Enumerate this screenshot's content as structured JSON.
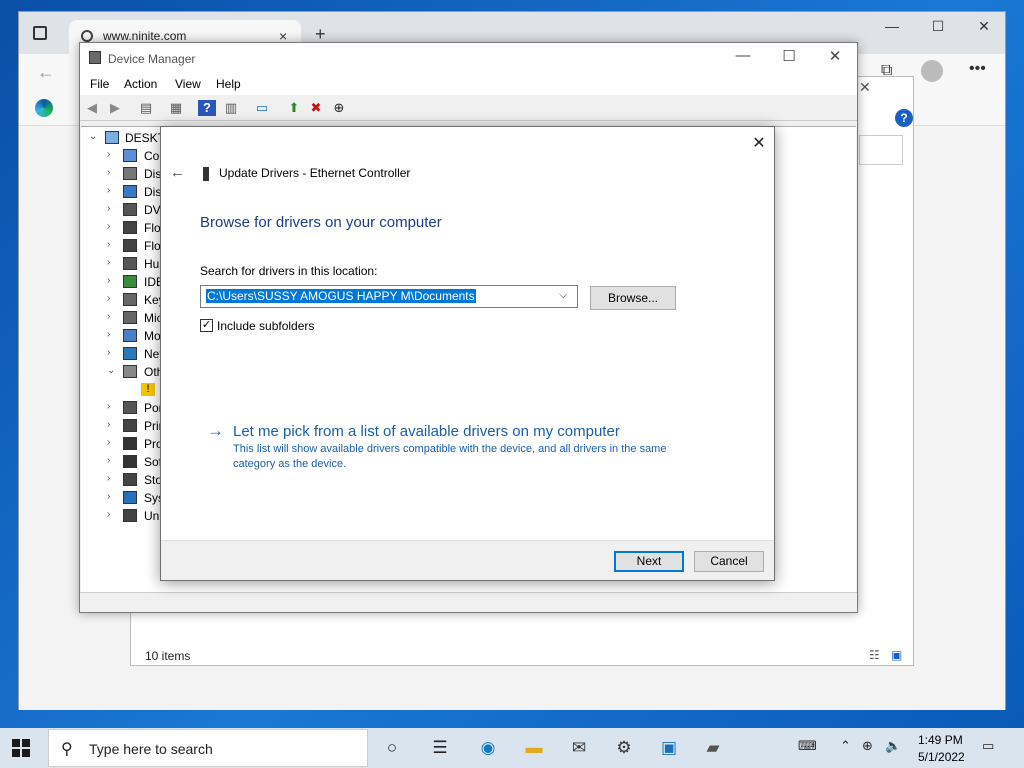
{
  "browser": {
    "tab_title": "www.ninite.com",
    "tab_close": "×",
    "new_tab": "+",
    "minimize": "—",
    "maximize": "☐",
    "close": "✕"
  },
  "explorer": {
    "status_items": "10 items"
  },
  "device_manager": {
    "title": "Device Manager",
    "minimize": "—",
    "maximize": "☐",
    "close": "✕",
    "menu": [
      "File",
      "Action",
      "View",
      "Help"
    ],
    "tree_root": "DESKTO",
    "tree_items": [
      {
        "label": "Cor",
        "expand": "›"
      },
      {
        "label": "Disk",
        "expand": "›"
      },
      {
        "label": "Disp",
        "expand": "›"
      },
      {
        "label": "DVD",
        "expand": "›"
      },
      {
        "label": "Flop",
        "expand": "›"
      },
      {
        "label": "Flop",
        "expand": "›"
      },
      {
        "label": "Hun",
        "expand": "›"
      },
      {
        "label": "IDE",
        "expand": "›"
      },
      {
        "label": "Key",
        "expand": "›"
      },
      {
        "label": "Mic",
        "expand": "›"
      },
      {
        "label": "Mo",
        "expand": "›"
      },
      {
        "label": "Net",
        "expand": "›"
      },
      {
        "label": "Oth",
        "expand": "⌄"
      },
      {
        "label": "",
        "expand": ""
      },
      {
        "label": "Por",
        "expand": "›"
      },
      {
        "label": "Prin",
        "expand": "›"
      },
      {
        "label": "Pro",
        "expand": "›"
      },
      {
        "label": "Sof",
        "expand": "›"
      },
      {
        "label": "Sto",
        "expand": "›"
      },
      {
        "label": "Syst",
        "expand": "›"
      },
      {
        "label": "Uni",
        "expand": "›"
      }
    ]
  },
  "dialog": {
    "title": "Update Drivers - Ethernet Controller",
    "close": "✕",
    "back": "←",
    "heading": "Browse for drivers on your computer",
    "search_label": "Search for drivers in this location:",
    "path": "C:\\Users\\SUSSY AMOGUS HAPPY M\\Documents",
    "browse_button": "Browse...",
    "include_subfolders": "Include subfolders",
    "checkbox_mark": "✓",
    "pick_arrow": "→",
    "pick_link": "Let me pick from a list of available drivers on my computer",
    "pick_description": "This list will show available drivers compatible with the device, and all drivers in the same category as the device.",
    "next_button": "Next",
    "cancel_button": "Cancel"
  },
  "taskbar": {
    "search_placeholder": "Type here to search",
    "time": "1:49 PM",
    "date": "5/1/2022"
  }
}
